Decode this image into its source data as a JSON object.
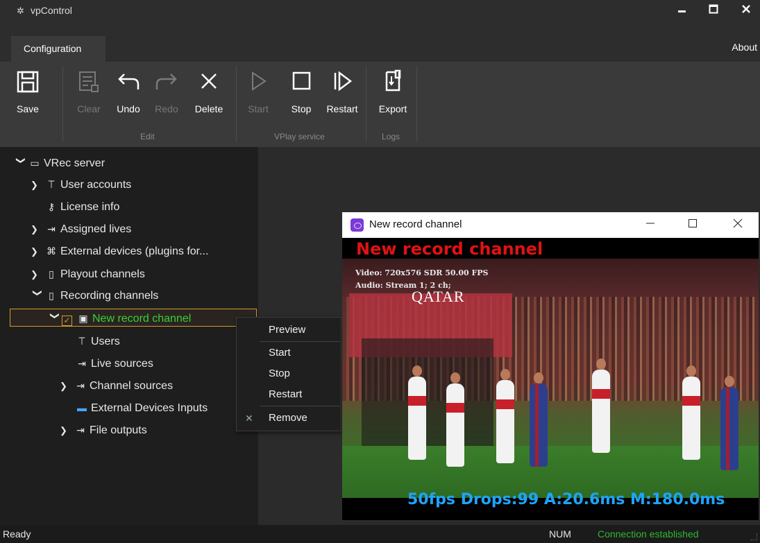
{
  "window": {
    "title": "vpControl"
  },
  "tabs": {
    "configuration": "Configuration",
    "about": "About"
  },
  "ribbon": {
    "save": "Save",
    "clear": "Clear",
    "undo": "Undo",
    "redo": "Redo",
    "delete": "Delete",
    "start": "Start",
    "stop": "Stop",
    "restart": "Restart",
    "export": "Export",
    "groups": {
      "edit": "Edit",
      "vplay": "VPlay service",
      "logs": "Logs"
    }
  },
  "tree": {
    "root": "VRec server",
    "user_accounts": "User accounts",
    "license_info": "License info",
    "assigned_lives": "Assigned lives",
    "external_devices": "External devices (plugins for...",
    "playout_channels": "Playout channels",
    "recording_channels": "Recording channels",
    "new_record_channel": "New record channel",
    "users": "Users",
    "live_sources": "Live sources",
    "channel_sources": "Channel sources",
    "external_devices_inputs": "External Devices Inputs",
    "file_outputs": "File outputs"
  },
  "context_menu": {
    "preview": "Preview",
    "start": "Start",
    "stop": "Stop",
    "restart": "Restart",
    "remove": "Remove"
  },
  "preview_window": {
    "title": "New record channel",
    "overlay_title": "New record channel",
    "video_info": "Video: 720x576 SDR 50.00 FPS",
    "audio_info": "Audio: Stream 1; 2 ch;",
    "stats": "50fps Drops:99 A:20.6ms M:180.0ms",
    "sponsor": "QATAR"
  },
  "status": {
    "ready": "Ready",
    "num": "NUM",
    "connection": "Connection established"
  },
  "colors": {
    "selection_border": "#d39a2a",
    "active_node_text": "#38d038",
    "overlay_title": "#e21212",
    "overlay_stats": "#1ea4ff",
    "connection_status": "#2db92d"
  }
}
